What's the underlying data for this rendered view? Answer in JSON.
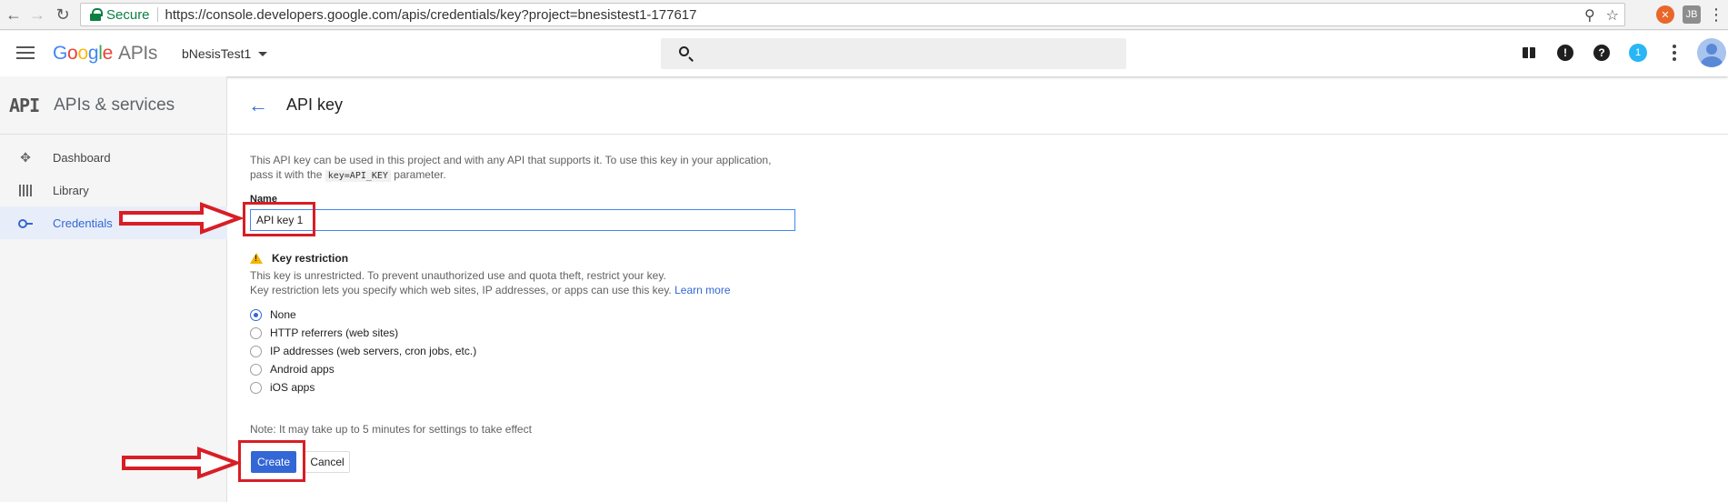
{
  "browser": {
    "secure_label": "Secure",
    "url": "https://console.developers.google.com/apis/credentials/key?project=bnesistest1-177617",
    "ext_badge": "JB"
  },
  "header": {
    "logo_google": [
      "G",
      "o",
      "o",
      "g",
      "l",
      "e"
    ],
    "logo_apis": "APIs",
    "project": "bNesisTest1",
    "notification_count": "1"
  },
  "sidebar": {
    "badge": "API",
    "title": "APIs & services",
    "items": [
      {
        "label": "Dashboard",
        "icon": "dashboard-icon"
      },
      {
        "label": "Library",
        "icon": "library-icon"
      },
      {
        "label": "Credentials",
        "icon": "key-icon",
        "active": true
      }
    ]
  },
  "main": {
    "title": "API key",
    "desc_line1": "This API key can be used in this project and with any API that supports it. To use this key in your application,",
    "desc_pre": "pass it with the",
    "desc_code": "key=API_KEY",
    "desc_post": "parameter.",
    "name_label": "Name",
    "name_value": "API key 1",
    "key_restriction": {
      "title": "Key restriction",
      "line1": "This key is unrestricted. To prevent unauthorized use and quota theft, restrict your key.",
      "line2": "Key restriction lets you specify which web sites, IP addresses, or apps can use this key.",
      "learn_more": "Learn more"
    },
    "options": [
      {
        "label": "None",
        "checked": true
      },
      {
        "label": "HTTP referrers (web sites)",
        "checked": false
      },
      {
        "label": "IP addresses (web servers, cron jobs, etc.)",
        "checked": false
      },
      {
        "label": "Android apps",
        "checked": false
      },
      {
        "label": "iOS apps",
        "checked": false
      }
    ],
    "note": "Note: It may take up to 5 minutes for settings to take effect",
    "create_label": "Create",
    "cancel_label": "Cancel"
  },
  "colors": {
    "accent": "#3367d6",
    "annotation": "#d81e26",
    "warning": "#f4b400"
  }
}
